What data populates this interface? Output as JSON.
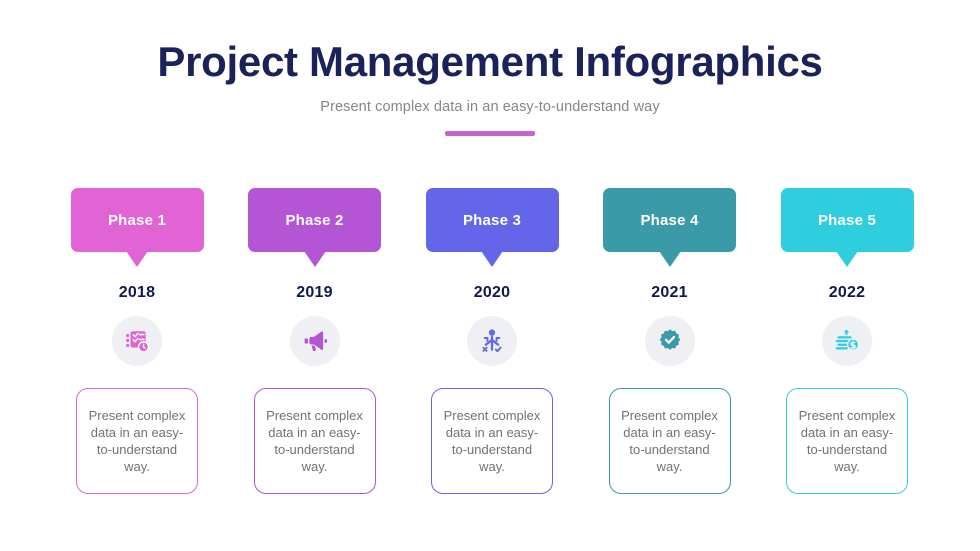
{
  "header": {
    "title": "Project Management Infographics",
    "subtitle": "Present complex data in an easy-to-understand way",
    "accent_color": "#c762d0",
    "title_color": "#1b2259",
    "subtitle_color": "#84868c"
  },
  "phases": [
    {
      "label": "Phase 1",
      "year": "2018",
      "description": "Present complex data in an easy-to-understand way.",
      "color": "#e263d4",
      "icon": "checklist-clock-icon"
    },
    {
      "label": "Phase 2",
      "year": "2019",
      "description": "Present complex data in an easy-to-understand way.",
      "color": "#b355d4",
      "icon": "megaphone-icon"
    },
    {
      "label": "Phase 3",
      "year": "2020",
      "description": "Present complex data in an easy-to-understand way.",
      "color": "#6366e8",
      "icon": "decision-person-icon"
    },
    {
      "label": "Phase 4",
      "year": "2021",
      "description": "Present complex data in an easy-to-understand way.",
      "color": "#3a9aa8",
      "icon": "verified-badge-icon"
    },
    {
      "label": "Phase 5",
      "year": "2022",
      "description": "Present complex data in an easy-to-understand way.",
      "color": "#2ecede",
      "icon": "money-stack-icon"
    }
  ],
  "icon_circle_bg": "#eef0f4",
  "background": "#ffffff"
}
